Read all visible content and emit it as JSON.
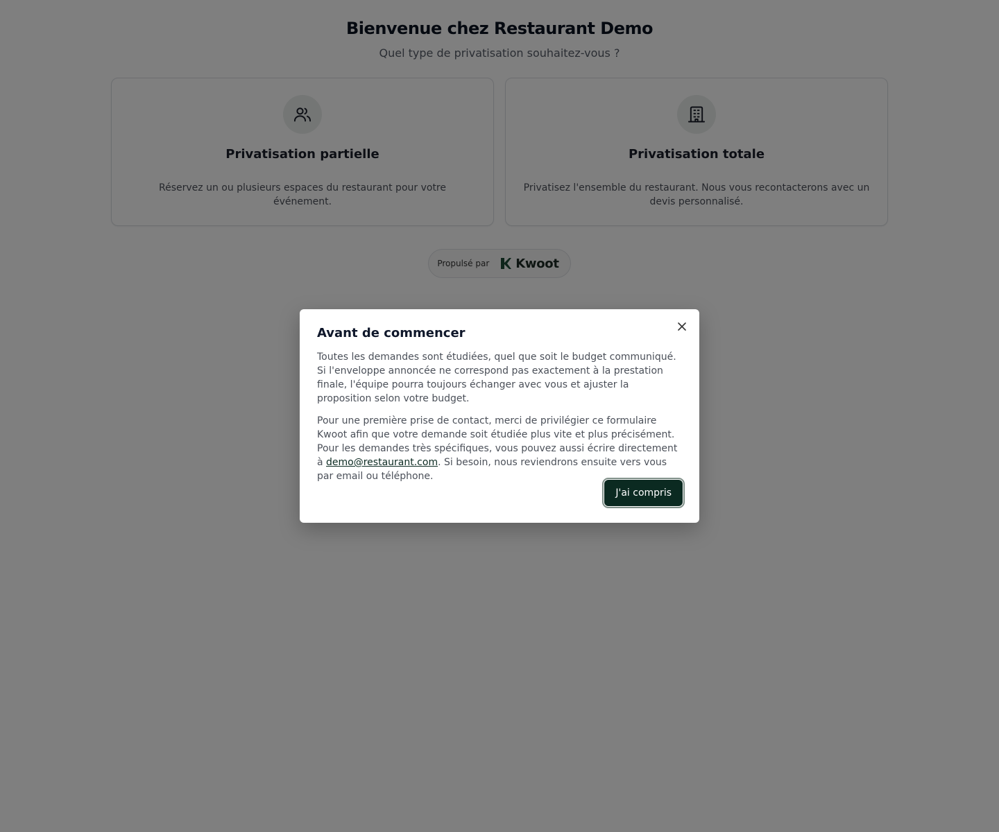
{
  "header": {
    "title": "Bienvenue chez Restaurant Demo",
    "subtitle": "Quel type de privatisation souhaitez-vous ?"
  },
  "options": [
    {
      "icon": "users-icon",
      "title": "Privatisation partielle",
      "description": "Réservez un ou plusieurs espaces du restaurant pour votre événement."
    },
    {
      "icon": "building-icon",
      "title": "Privatisation totale",
      "description": "Privatisez l'ensemble du restaurant. Nous vous recontacterons avec un devis personnalisé."
    }
  ],
  "powered_by": {
    "label": "Propulsé par",
    "brand": "Kwoot"
  },
  "modal": {
    "title": "Avant de commencer",
    "paragraph1": "Toutes les demandes sont étudiées, quel que soit le budget communiqué. Si l'enveloppe annoncée ne correspond pas exactement à la prestation finale, l'équipe pourra toujours échanger avec vous et ajuster la proposition selon votre budget.",
    "paragraph2_before": "Pour une première prise de contact, merci de privilégier ce formulaire Kwoot afin que votre demande soit étudiée plus vite et plus précisément. Pour les demandes très spécifiques, vous pouvez aussi écrire directement à ",
    "email": "demo@restaurant.com",
    "paragraph2_after": ". Si besoin, nous reviendrons ensuite vers vous par email ou téléphone.",
    "confirm_label": "J'ai compris",
    "close_icon": "close-icon"
  },
  "colors": {
    "accent": "#0b2a21",
    "overlay": "rgba(0,0,0,0.5)"
  }
}
